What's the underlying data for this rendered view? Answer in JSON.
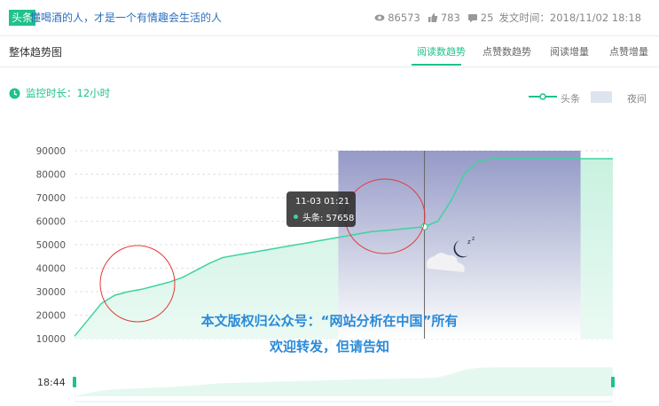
{
  "header": {
    "badge": "头条",
    "title": "懂喝酒的人，才是一个有情趣会生活的人",
    "views": "86573",
    "likes": "783",
    "comments": "25",
    "publish_time": "发文时间：2018/11/02 18:18"
  },
  "tabs": {
    "section_title": "整体趋势图",
    "items": [
      "阅读数趋势",
      "点赞数趋势",
      "阅读增量",
      "点赞增量"
    ],
    "active_index": 0
  },
  "monitor": {
    "label": "监控时长：12小时"
  },
  "legend": {
    "series_label": "头条",
    "night_label": "夜间"
  },
  "tooltip": {
    "date": "11-03 01:21",
    "series_value": "头条:  57658"
  },
  "watermark": {
    "line1": "本文版权归公众号：“网站分析在中国”所有",
    "line2": "欢迎转发，但请告知"
  },
  "slider": {
    "start_label": "18:44"
  },
  "colors": {
    "accent": "#1ec28b",
    "night_top": "#9b9fc9",
    "watermark": "#2a8ad8"
  },
  "chart_data": {
    "type": "area",
    "y_ticks": [
      "90000",
      "80000",
      "70000",
      "60000",
      "50000",
      "40000",
      "30000",
      "20000",
      "10000"
    ],
    "ylim": [
      10000,
      90000
    ],
    "series": [
      {
        "name": "头条",
        "values": [
          11000,
          18000,
          25000,
          28500,
          30000,
          31000,
          32500,
          34000,
          36000,
          39000,
          42000,
          44500,
          45500,
          46500,
          47500,
          48500,
          49500,
          50500,
          51500,
          52500,
          53500,
          54500,
          55500,
          56000,
          56500,
          57000,
          57658,
          60000,
          69000,
          80500,
          85500,
          86500,
          86600,
          86600,
          86600,
          86600,
          86600,
          86600,
          86600,
          86600,
          86600
        ]
      }
    ],
    "night_range": [
      0.49,
      0.94
    ],
    "highlight_index": 26
  }
}
